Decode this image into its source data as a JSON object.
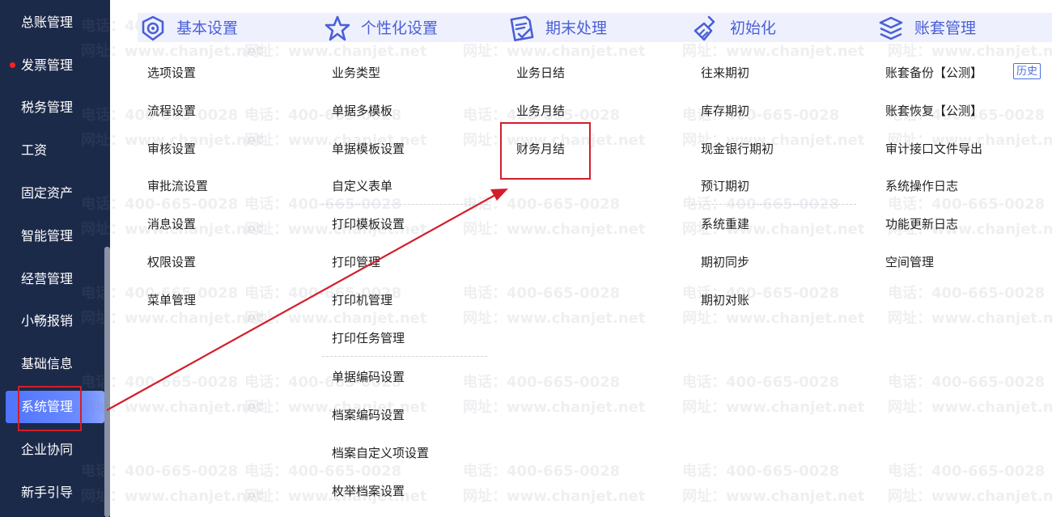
{
  "sidebar": {
    "items": [
      {
        "label": "总账管理"
      },
      {
        "label": "发票管理"
      },
      {
        "label": "税务管理"
      },
      {
        "label": "工资"
      },
      {
        "label": "固定资产"
      },
      {
        "label": "智能管理"
      },
      {
        "label": "经营管理"
      },
      {
        "label": "小畅报销"
      },
      {
        "label": "基础信息"
      },
      {
        "label": "系统管理"
      },
      {
        "label": "企业协同"
      },
      {
        "label": "新手引导"
      }
    ],
    "active_label": "系统管理",
    "notification_dot_color": "#ff2020"
  },
  "watermark": {
    "phone": "电话：400-665-0028",
    "site": "网址：www.chanjet.net"
  },
  "columns": [
    {
      "title": "基本设置",
      "icon": "gear-badge-icon",
      "items": [
        "选项设置",
        "流程设置",
        "审核设置",
        "审批流设置",
        "消息设置",
        "权限设置",
        "菜单管理"
      ]
    },
    {
      "title": "个性化设置",
      "icon": "star-icon",
      "items": [
        "业务类型",
        "单据多模板",
        "单据模板设置",
        "自定义表单",
        "打印模板设置",
        "打印管理",
        "打印机管理",
        "打印任务管理",
        "单据编码设置",
        "档案编码设置",
        "档案自定义项设置",
        "枚举档案设置"
      ]
    },
    {
      "title": "期末处理",
      "icon": "document-check-icon",
      "items": [
        "业务日结",
        "业务月结",
        "财务月结"
      ]
    },
    {
      "title": "初始化",
      "icon": "broom-icon",
      "items": [
        "往来期初",
        "库存期初",
        "现金银行期初",
        "预订期初",
        "系统重建",
        "期初同步",
        "期初对账"
      ]
    },
    {
      "title": "账套管理",
      "icon": "ledger-stack-icon",
      "items": [
        "账套备份【公测】",
        "账套恢复【公测】",
        "审计接口文件导出",
        "系统操作日志",
        "功能更新日志",
        "空间管理"
      ],
      "history_button": "历史"
    }
  ],
  "colors": {
    "sidebar_bg": "#1c2a4a",
    "active_item": "#5a7cff",
    "header_text": "#4b5fd8",
    "header_bg": "#eef1fd",
    "annotation_red": "#d21e2a"
  }
}
